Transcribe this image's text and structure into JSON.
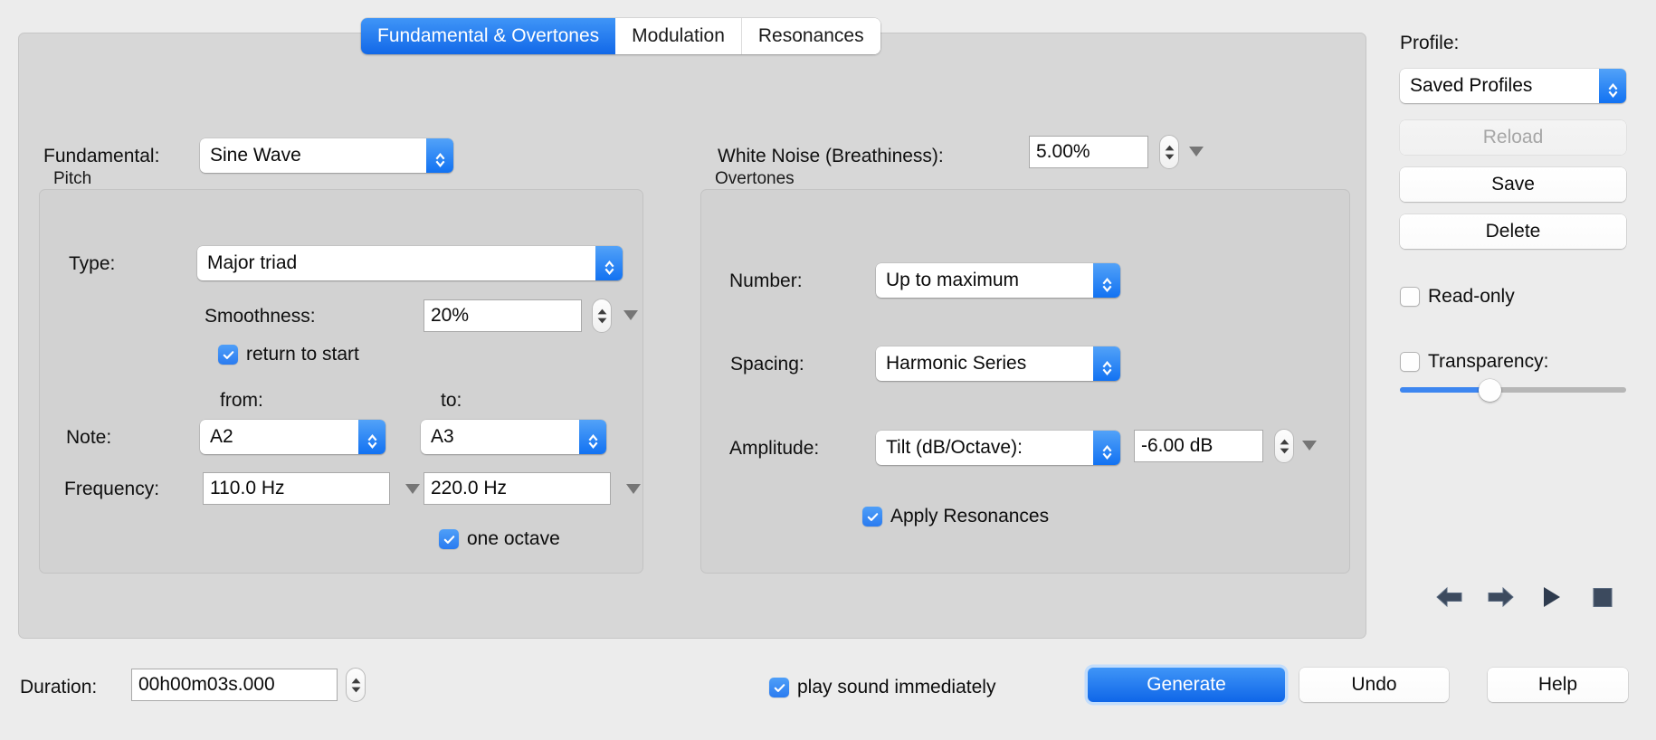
{
  "tabs": [
    {
      "label": "Fundamental & Overtones",
      "active": true
    },
    {
      "label": "Modulation",
      "active": false
    },
    {
      "label": "Resonances",
      "active": false
    }
  ],
  "left": {
    "fundamental_label": "Fundamental:",
    "fundamental_value": "Sine Wave",
    "pitch_group_title": "Pitch",
    "type_label": "Type:",
    "type_value": "Major triad",
    "smoothness_label": "Smoothness:",
    "smoothness_value": "20%",
    "return_to_start_label": "return to start",
    "from_label": "from:",
    "to_label": "to:",
    "note_label": "Note:",
    "note_from_value": "A2",
    "note_to_value": "A3",
    "frequency_label": "Frequency:",
    "frequency_from_value": "110.0 Hz",
    "frequency_to_value": "220.0 Hz",
    "one_octave_label": "one octave"
  },
  "right": {
    "white_noise_label": "White Noise (Breathiness):",
    "white_noise_value": "5.00%",
    "overtones_group_title": "Overtones",
    "number_label": "Number:",
    "number_value": "Up to maximum",
    "spacing_label": "Spacing:",
    "spacing_value": "Harmonic Series",
    "amplitude_label": "Amplitude:",
    "amplitude_mode_value": "Tilt (dB/Octave):",
    "amplitude_tilt_value": "-6.00 dB",
    "apply_resonances_label": "Apply Resonances"
  },
  "profile": {
    "title": "Profile:",
    "selected": "Saved Profiles",
    "reload_label": "Reload",
    "save_label": "Save",
    "delete_label": "Delete",
    "read_only_label": "Read-only",
    "transparency_label": "Transparency:"
  },
  "transport": {
    "back_icon": "arrow-left-icon",
    "forward_icon": "arrow-right-icon",
    "play_icon": "play-icon",
    "stop_icon": "stop-icon"
  },
  "footer": {
    "duration_label": "Duration:",
    "duration_value": "00h00m03s.000",
    "play_immediately_label": "play sound immediately",
    "generate_label": "Generate",
    "undo_label": "Undo",
    "help_label": "Help"
  },
  "colors": {
    "accent_blue": "#1272f2",
    "window_bg": "#ececec",
    "panel_bg": "#d7d7d7",
    "group_bg": "#d2d2d2",
    "transport_icon": "#3c4a5e"
  }
}
